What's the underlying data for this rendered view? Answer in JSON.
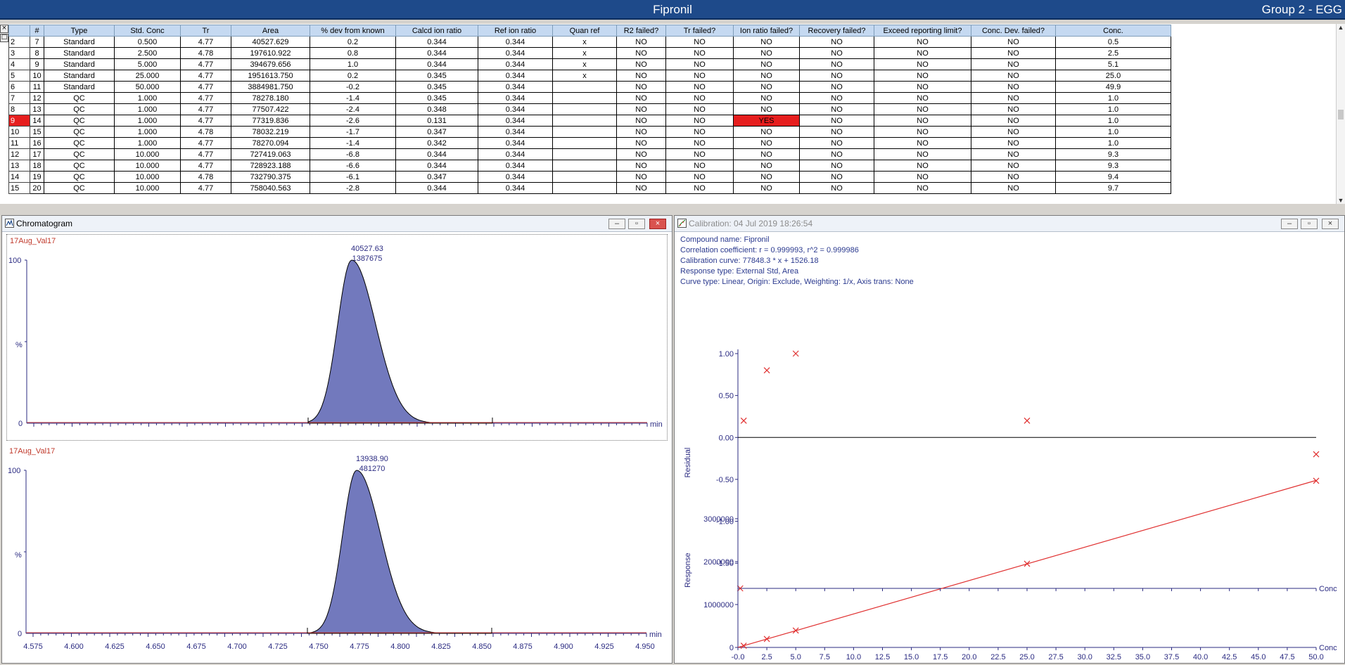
{
  "window": {
    "title": "Fipronil",
    "group": "Group 2 - EGG"
  },
  "grid": {
    "columns": [
      "",
      "#",
      "Type",
      "Std. Conc",
      "Tr",
      "Area",
      "% dev from known",
      "Calcd ion ratio",
      "Ref ion ratio",
      "Quan ref",
      "R2 failed?",
      "Tr failed?",
      "Ion ratio failed?",
      "Recovery failed?",
      "Exceed reporting limit?",
      "Conc. Dev. failed?",
      "Conc."
    ],
    "rows": [
      [
        "2",
        "7",
        "Standard",
        "0.500",
        "4.77",
        "40527.629",
        "0.2",
        "0.344",
        "0.344",
        "x",
        "NO",
        "NO",
        "NO",
        "NO",
        "NO",
        "NO",
        "0.5"
      ],
      [
        "3",
        "8",
        "Standard",
        "2.500",
        "4.78",
        "197610.922",
        "0.8",
        "0.344",
        "0.344",
        "x",
        "NO",
        "NO",
        "NO",
        "NO",
        "NO",
        "NO",
        "2.5"
      ],
      [
        "4",
        "9",
        "Standard",
        "5.000",
        "4.77",
        "394679.656",
        "1.0",
        "0.344",
        "0.344",
        "x",
        "NO",
        "NO",
        "NO",
        "NO",
        "NO",
        "NO",
        "5.1"
      ],
      [
        "5",
        "10",
        "Standard",
        "25.000",
        "4.77",
        "1951613.750",
        "0.2",
        "0.345",
        "0.344",
        "x",
        "NO",
        "NO",
        "NO",
        "NO",
        "NO",
        "NO",
        "25.0"
      ],
      [
        "6",
        "11",
        "Standard",
        "50.000",
        "4.77",
        "3884981.750",
        "-0.2",
        "0.345",
        "0.344",
        "",
        "NO",
        "NO",
        "NO",
        "NO",
        "NO",
        "NO",
        "49.9"
      ],
      [
        "7",
        "12",
        "QC",
        "1.000",
        "4.77",
        "78278.180",
        "-1.4",
        "0.345",
        "0.344",
        "",
        "NO",
        "NO",
        "NO",
        "NO",
        "NO",
        "NO",
        "1.0"
      ],
      [
        "8",
        "13",
        "QC",
        "1.000",
        "4.77",
        "77507.422",
        "-2.4",
        "0.348",
        "0.344",
        "",
        "NO",
        "NO",
        "NO",
        "NO",
        "NO",
        "NO",
        "1.0"
      ],
      [
        "9",
        "14",
        "QC",
        "1.000",
        "4.77",
        "77319.836",
        "-2.6",
        "0.131",
        "0.344",
        "",
        "NO",
        "NO",
        "YES",
        "NO",
        "NO",
        "NO",
        "1.0"
      ],
      [
        "10",
        "15",
        "QC",
        "1.000",
        "4.78",
        "78032.219",
        "-1.7",
        "0.347",
        "0.344",
        "",
        "NO",
        "NO",
        "NO",
        "NO",
        "NO",
        "NO",
        "1.0"
      ],
      [
        "11",
        "16",
        "QC",
        "1.000",
        "4.77",
        "78270.094",
        "-1.4",
        "0.342",
        "0.344",
        "",
        "NO",
        "NO",
        "NO",
        "NO",
        "NO",
        "NO",
        "1.0"
      ],
      [
        "12",
        "17",
        "QC",
        "10.000",
        "4.77",
        "727419.063",
        "-6.8",
        "0.344",
        "0.344",
        "",
        "NO",
        "NO",
        "NO",
        "NO",
        "NO",
        "NO",
        "9.3"
      ],
      [
        "13",
        "18",
        "QC",
        "10.000",
        "4.77",
        "728923.188",
        "-6.6",
        "0.344",
        "0.344",
        "",
        "NO",
        "NO",
        "NO",
        "NO",
        "NO",
        "NO",
        "9.3"
      ],
      [
        "14",
        "19",
        "QC",
        "10.000",
        "4.78",
        "732790.375",
        "-6.1",
        "0.347",
        "0.344",
        "",
        "NO",
        "NO",
        "NO",
        "NO",
        "NO",
        "NO",
        "9.4"
      ],
      [
        "15",
        "20",
        "QC",
        "10.000",
        "4.77",
        "758040.563",
        "-2.8",
        "0.344",
        "0.344",
        "",
        "NO",
        "NO",
        "NO",
        "NO",
        "NO",
        "NO",
        "9.7"
      ]
    ],
    "selected_row": "9",
    "fail_value": "YES"
  },
  "chromatogram": {
    "title": "Chromatogram",
    "min_label": "min",
    "x_ticks": [
      "4.575",
      "4.600",
      "4.625",
      "4.650",
      "4.675",
      "4.700",
      "4.725",
      "4.750",
      "4.775",
      "4.800",
      "4.825",
      "4.850",
      "4.875",
      "4.900",
      "4.925",
      "4.950"
    ],
    "traces": [
      {
        "sample": "17Aug_Val17",
        "peak_area": "40527.63",
        "peak_height": "1387675",
        "y_top": "100",
        "y_mid": "%",
        "y_zero": "0"
      },
      {
        "sample": "17Aug_Val17",
        "peak_area": "13938.90",
        "peak_height": "481270",
        "y_top": "100",
        "y_mid": "%",
        "y_zero": "0"
      }
    ],
    "colors": {
      "fill": "#7279bd",
      "baseline": "#d04040"
    }
  },
  "calibration": {
    "title": "Calibration: 04 Jul 2019 18:26:54",
    "compound": "Compound name: Fipronil",
    "correlation": "Correlation coefficient: r = 0.999993, r^2 = 0.999986",
    "curve": "Calibration curve: 77848.3 * x + 1526.18",
    "response_type": "Response type: External Std, Area",
    "curve_type": "Curve type: Linear, Origin: Exclude, Weighting: 1/x, Axis trans: None",
    "residual_axis": "Residual",
    "response_axis": "Response",
    "conc_label": "Conc",
    "residual_ticks": [
      "1.00",
      "0.50",
      "0.00",
      "-0.50",
      "-1.00",
      "-1.50"
    ],
    "response_ticks": [
      "3000000",
      "2000000",
      "1000000",
      "0"
    ],
    "x_ticks": [
      "-0.0",
      "2.5",
      "5.0",
      "7.5",
      "10.0",
      "12.5",
      "15.0",
      "17.5",
      "20.0",
      "22.5",
      "25.0",
      "27.5",
      "30.0",
      "32.5",
      "35.0",
      "37.5",
      "40.0",
      "42.5",
      "45.0",
      "47.5",
      "50.0"
    ],
    "color": "#e03030"
  },
  "chart_data": [
    {
      "type": "scatter",
      "title": "",
      "xlabel": "Conc",
      "ylabel": "Residual",
      "xlim": [
        0,
        50
      ],
      "ylim": [
        -1.8,
        1.0
      ],
      "x": [
        0.5,
        2.5,
        5.0,
        25.0,
        50.0
      ],
      "y": [
        0.2,
        0.8,
        1.0,
        0.2,
        -0.2
      ]
    },
    {
      "type": "line",
      "title": "",
      "xlabel": "Conc",
      "ylabel": "Response",
      "xlim": [
        0,
        50
      ],
      "ylim": [
        0,
        3900000
      ],
      "x": [
        0.5,
        2.5,
        5.0,
        25.0,
        50.0
      ],
      "y": [
        40527.629,
        197610.922,
        394679.656,
        1951613.75,
        3884981.75
      ],
      "fit": {
        "slope": 77848.3,
        "intercept": 1526.18
      }
    }
  ]
}
